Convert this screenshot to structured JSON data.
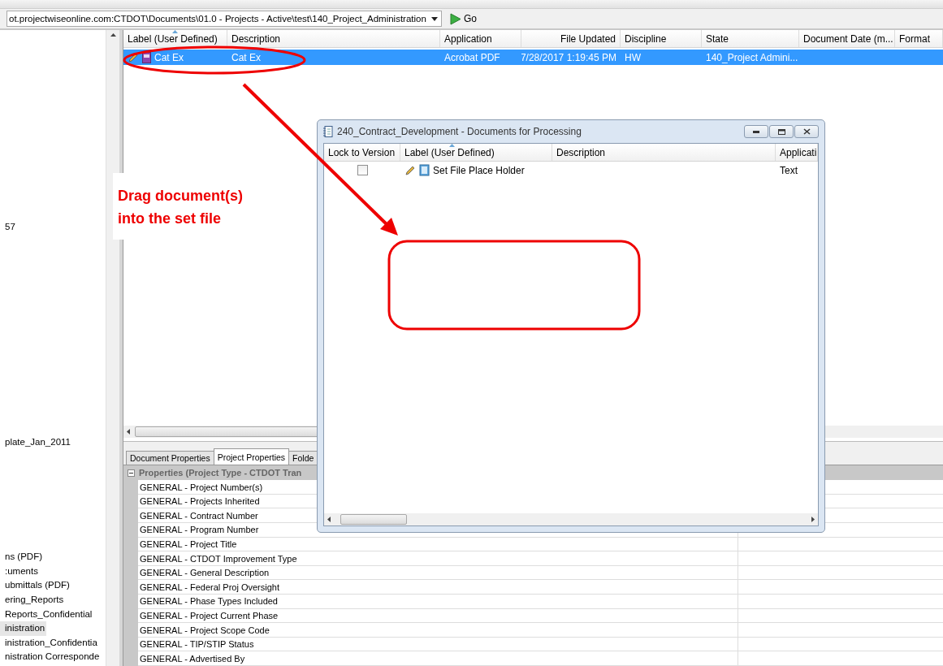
{
  "address_bar": {
    "value": "ot.projectwiseonline.com:CTDOT\\Documents\\01.0 - Projects - Active\\test\\140_Project_Administration",
    "go_label": "Go"
  },
  "folder_tree": {
    "items": [
      {
        "label": "57",
        "selected": false
      },
      {
        "label": "plate_Jan_2011",
        "selected": false
      },
      {
        "label": "ns (PDF)",
        "selected": false
      },
      {
        "label": ":uments",
        "selected": false
      },
      {
        "label": "ubmittals (PDF)",
        "selected": false
      },
      {
        "label": "ering_Reports",
        "selected": false
      },
      {
        "label": "Reports_Confidential",
        "selected": false
      },
      {
        "label": "inistration",
        "selected": true
      },
      {
        "label": "inistration_Confidentia",
        "selected": false
      },
      {
        "label": "nistration Corresponde",
        "selected": false
      }
    ]
  },
  "document_list": {
    "columns": [
      "Label (User Defined)",
      "Description",
      "Application",
      "File Updated",
      "Discipline",
      "State",
      "Document Date (m...",
      "Format"
    ],
    "rows": [
      {
        "selected": true,
        "cells": [
          "Cat Ex",
          "Cat Ex",
          "Acrobat PDF",
          "7/28/2017 1:19:45 PM",
          "HW",
          "140_Project Admini...",
          "",
          ""
        ]
      }
    ]
  },
  "property_tabs": [
    {
      "label": "Document Properties",
      "selected": false
    },
    {
      "label": "Project Properties",
      "selected": true
    },
    {
      "label": "Folde",
      "selected": false
    }
  ],
  "properties": {
    "group": "Properties (Project Type - CTDOT Tran",
    "expanded": true,
    "rows": [
      "GENERAL - Project Number(s)",
      "GENERAL - Projects Inherited",
      "GENERAL - Contract Number",
      "GENERAL - Program Number",
      "GENERAL - Project Title",
      "GENERAL - CTDOT Improvement Type",
      "GENERAL - General Description",
      "GENERAL - Federal Proj Oversight",
      "GENERAL - Phase Types Included",
      "GENERAL - Project Current Phase",
      "GENERAL - Project Scope Code",
      "GENERAL - TIP/STIP Status",
      "GENERAL - Advertised By"
    ]
  },
  "dialog": {
    "title": "240_Contract_Development - Documents for Processing",
    "columns": [
      "Lock to Version",
      "Label (User Defined)",
      "Description",
      "Applicati"
    ],
    "rows": [
      {
        "checked": false,
        "label": "Set File Place Holder",
        "description": "",
        "application": "Text"
      }
    ]
  },
  "annotation": {
    "callout": "Drag document(s)\ninto the set file"
  }
}
